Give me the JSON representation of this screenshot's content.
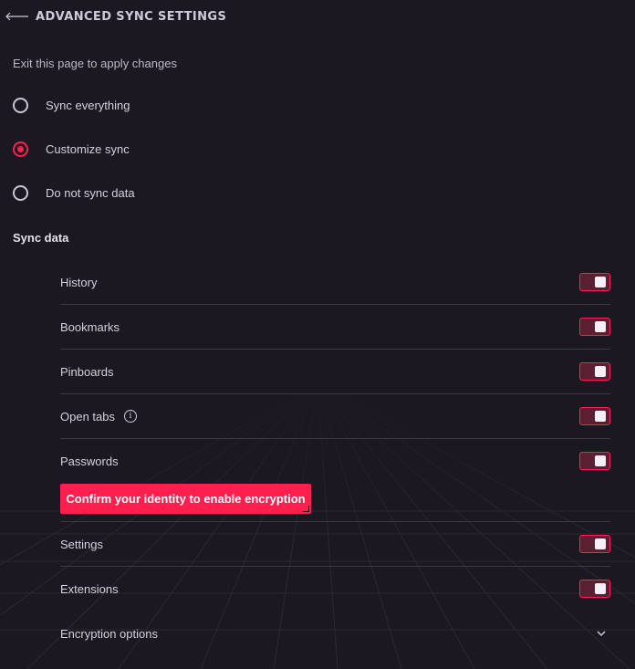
{
  "header": {
    "title": "ADVANCED SYNC SETTINGS"
  },
  "subtitle": "Exit this page to apply changes",
  "sync_mode": {
    "options": [
      {
        "label": "Sync everything",
        "selected": false
      },
      {
        "label": "Customize sync",
        "selected": true
      },
      {
        "label": "Do not sync data",
        "selected": false
      }
    ]
  },
  "sync_data": {
    "title": "Sync data",
    "items": [
      {
        "label": "History",
        "enabled": true
      },
      {
        "label": "Bookmarks",
        "enabled": true
      },
      {
        "label": "Pinboards",
        "enabled": true
      },
      {
        "label": "Open tabs",
        "enabled": true
      },
      {
        "label": "Passwords",
        "enabled": true
      },
      {
        "label": "Settings",
        "enabled": true
      },
      {
        "label": "Extensions",
        "enabled": true
      }
    ],
    "confirm_button": "Confirm your identity to enable encryption"
  },
  "encryption": {
    "label": "Encryption options"
  },
  "colors": {
    "accent": "#ff1f4f",
    "background": "#1c1821",
    "divider": "#3d3746"
  },
  "icons": [
    "back-arrow-icon",
    "info-icon",
    "chevron-down-icon"
  ]
}
